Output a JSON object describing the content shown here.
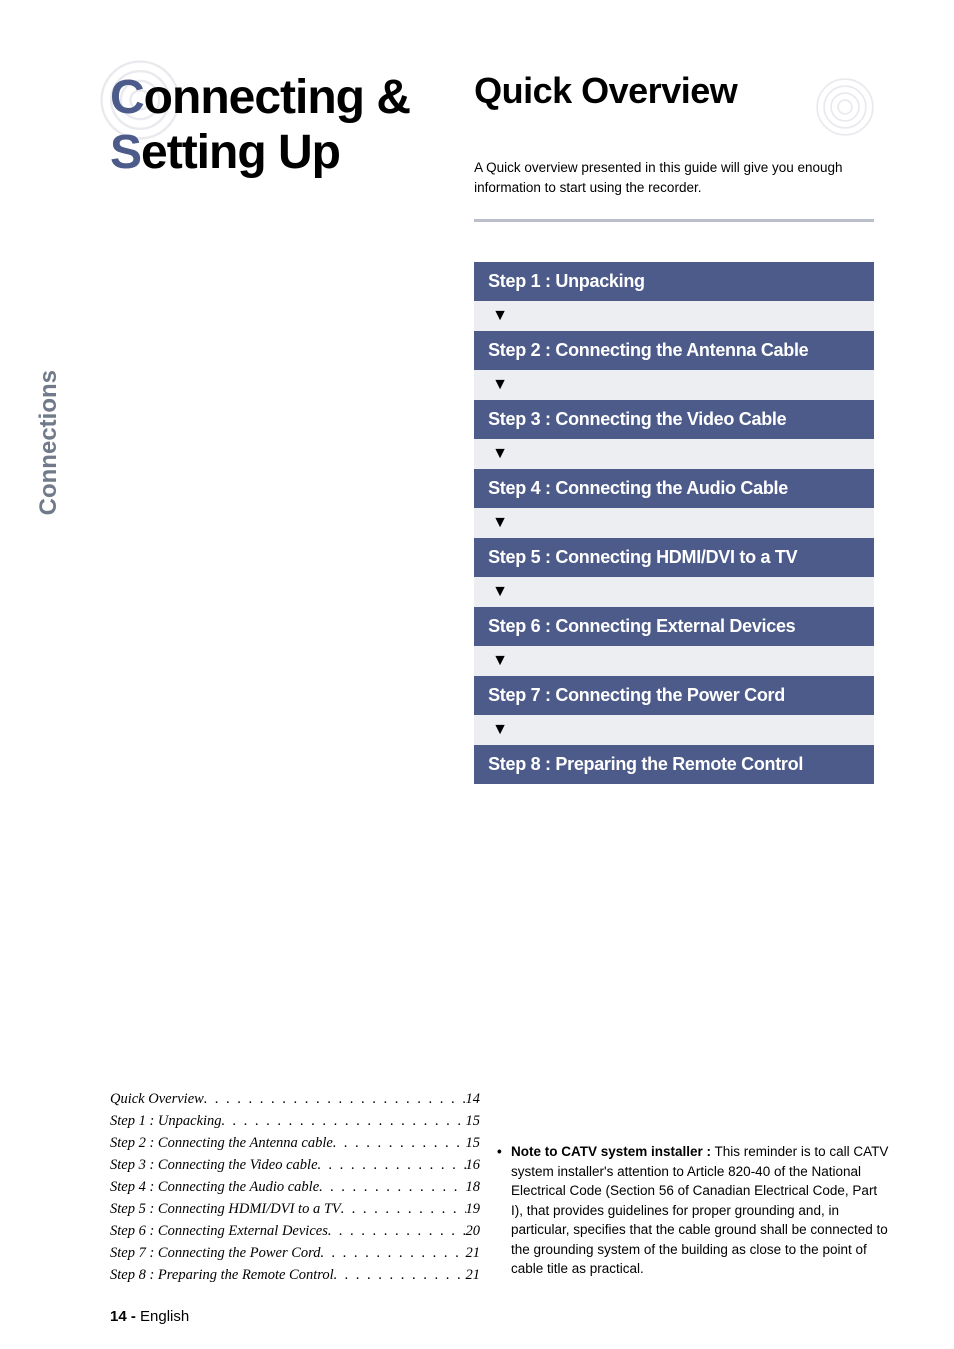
{
  "sidebar_label": "Connections",
  "main_title": {
    "line1_accent": "C",
    "line1_rest": "onnecting &",
    "line2_accent": "S",
    "line2_rest": "etting Up"
  },
  "overview": {
    "title": "Quick Overview",
    "desc": "A Quick overview presented in this guide will give you enough information to start using the recorder."
  },
  "steps": [
    "Step 1 : Unpacking",
    "Step 2 : Connecting the Antenna Cable",
    "Step 3 : Connecting the Video Cable",
    "Step 4 : Connecting the Audio Cable",
    "Step 5 : Connecting HDMI/DVI to a TV",
    "Step 6 : Connecting External Devices",
    "Step 7 : Connecting the Power Cord",
    "Step 8 : Preparing the Remote Control"
  ],
  "arrow": "▼",
  "toc": [
    {
      "label": "Quick Overview",
      "page": "14"
    },
    {
      "label": "Step 1 : Unpacking",
      "page": "15"
    },
    {
      "label": "Step 2 : Connecting the Antenna cable",
      "page": "15"
    },
    {
      "label": "Step 3 : Connecting the Video cable",
      "page": "16"
    },
    {
      "label": "Step 4 : Connecting the Audio cable",
      "page": "18"
    },
    {
      "label": "Step 5 : Connecting HDMI/DVI to a TV",
      "page": "19"
    },
    {
      "label": "Step 6 : Connecting External Devices",
      "page": "20"
    },
    {
      "label": "Step 7 : Connecting the Power Cord",
      "page": "21"
    },
    {
      "label": "Step 8 : Preparing the Remote Control",
      "page": "21"
    }
  ],
  "note": {
    "bullet": "•",
    "lead": "Note to CATV system installer :",
    "body": " This reminder is to call CATV system installer's attention to Article 820-40 of the National Electrical Code (Section 56 of Canadian Electrical Code, Part I), that provides guidelines for proper grounding and, in particular, specifies that the cable ground shall be connected to the grounding system of the building as close to the point of cable title as practical."
  },
  "footer": {
    "page_no": "14 -",
    "lang": " English"
  }
}
